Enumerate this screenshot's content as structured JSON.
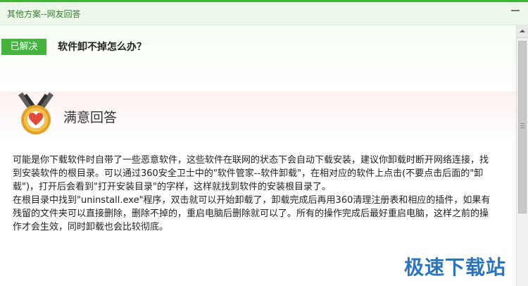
{
  "window": {
    "title": "其他方案--网友回答"
  },
  "question": {
    "badge": "已解决",
    "text": "软件卸不掉怎么办？"
  },
  "answer": {
    "title": "满意回答",
    "paragraph1": "可能是你下载软件时自带了一些恶意软件，这些软件在联网的状态下会自动下载安装，建议你卸载时断开网络连接，找到安装软件的根目录。可以通过360安全卫士中的\"软件管家--软件卸载\"，在相对应的软件上点击(不要点击后面的\"卸载\")，打开后会看到\"打开安装目录\"的字样，这样就找到软件的安装根目录了。",
    "paragraph2": "在根目录中找到\"uninstall.exe\"程序，双击就可以开始卸载了，卸载完成后再用360清理注册表和相应的插件，如果有残留的文件夹可以直接删除，删除不掉的，重启电脑后删除就可以了。所有的操作完成后最好重启电脑，这样之前的操作才会生效，同时卸载也会比较彻底。"
  },
  "watermark": {
    "text": "极速下载站"
  },
  "colors": {
    "accent_green": "#43b43f",
    "title_green": "#2f7d2d",
    "watermark_blue": "#2d74bf"
  },
  "icons": {
    "minimize": "minimize-icon",
    "medal": "medal-heart-icon",
    "scroll_up": "scroll-up-arrow-icon"
  }
}
